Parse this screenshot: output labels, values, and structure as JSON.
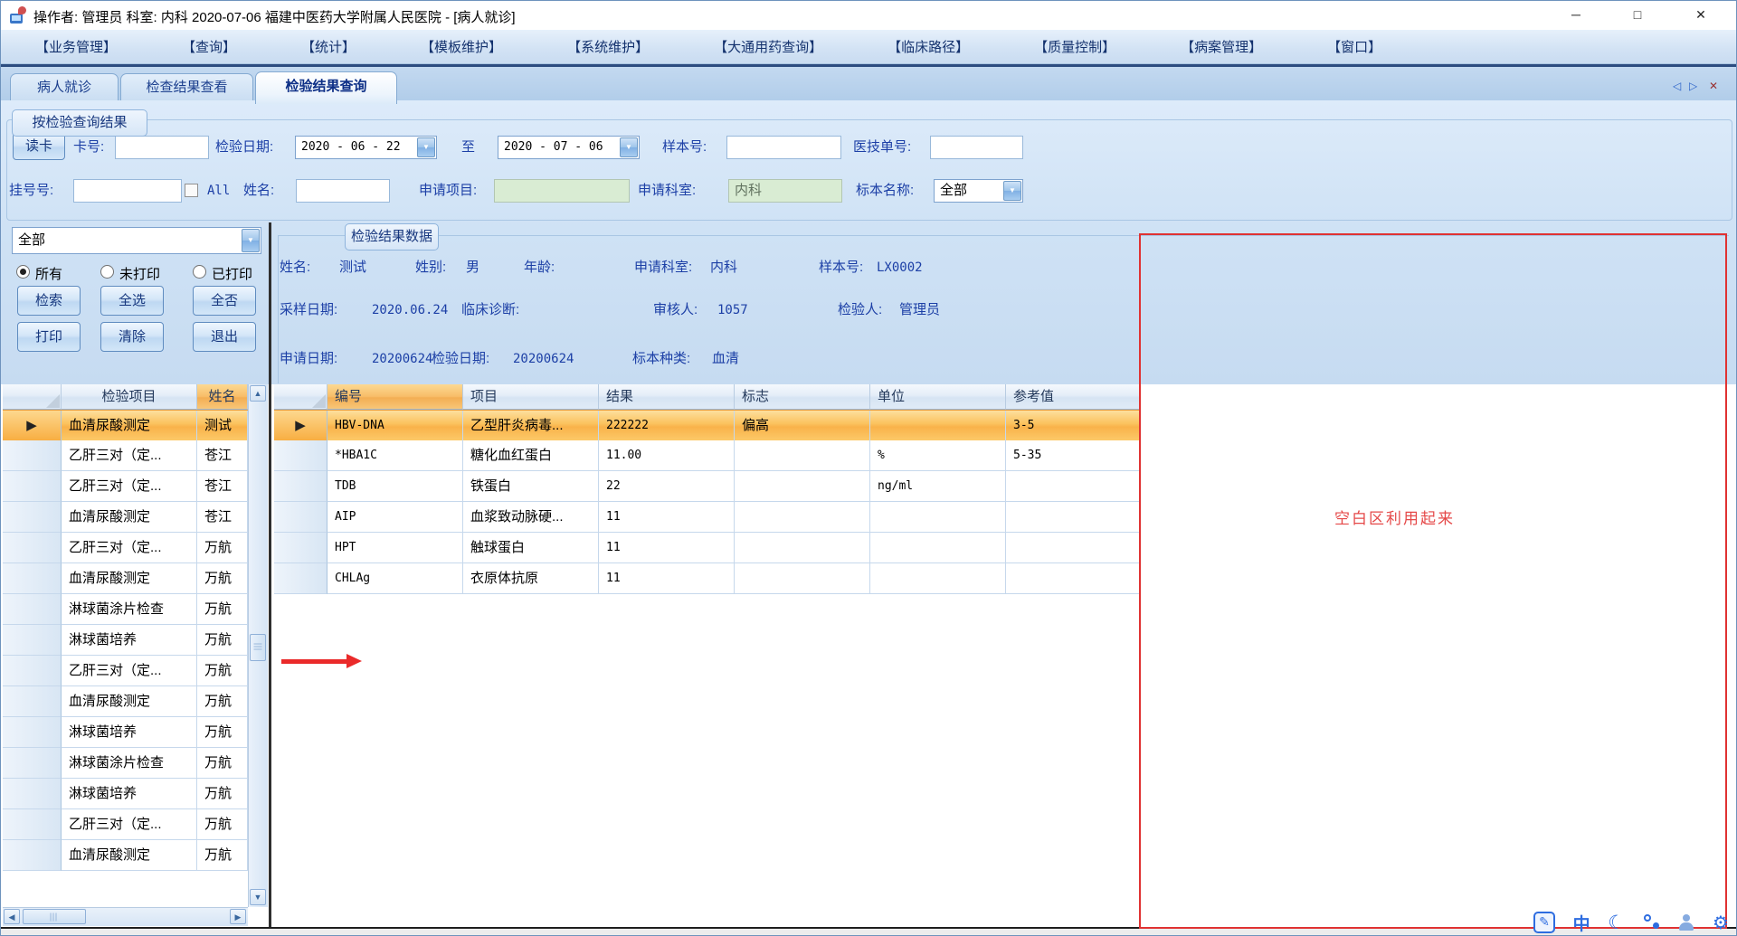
{
  "window": {
    "title": "操作者: 管理员 科室: 内科  2020-07-06  福建中医药大学附属人民医院 - [病人就诊]",
    "minimize": "─",
    "maximize": "□",
    "close": "✕"
  },
  "menu": {
    "items": [
      "【业务管理】",
      "【查询】",
      "【统计】",
      "【模板维护】",
      "【系统维护】",
      "【大通用药查询】",
      "【临床路径】",
      "【质量控制】",
      "【病案管理】",
      "【窗口】"
    ]
  },
  "tabs": {
    "items": [
      {
        "label": "病人就诊"
      },
      {
        "label": "检查结果查看"
      },
      {
        "label": "检验结果查询"
      }
    ],
    "nav_prev": "◁",
    "nav_next": "▷",
    "nav_close": "✕"
  },
  "query": {
    "group_label": "按检验查询结果",
    "read_card": "读卡",
    "card_no_label": "卡号:",
    "date_label": "检验日期:",
    "date_from": "2020 - 06 - 22",
    "to_label": "至",
    "date_to": "2020 - 07 - 06",
    "sample_label": "样本号:",
    "tech_no_label": "医技单号:",
    "reg_no_label": "挂号号:",
    "all_label": "All",
    "name_label": "姓名:",
    "apply_item_label": "申请项目:",
    "apply_dept_label": "申请科室:",
    "apply_dept_value": "内科",
    "specimen_label": "标本名称:",
    "specimen_value": "全部"
  },
  "left_panel": {
    "filter_value": "全部",
    "radio_all": "所有",
    "radio_unprinted": "未打印",
    "radio_printed": "已打印",
    "btn_search": "检索",
    "btn_select_all": "全选",
    "btn_select_none": "全否",
    "btn_print": "打印",
    "btn_clear": "清除",
    "btn_exit": "退出",
    "table": {
      "col_item": "检验项目",
      "col_name": "姓名",
      "rows": [
        {
          "item": "血清尿酸测定",
          "name": "测试"
        },
        {
          "item": "乙肝三对（定...",
          "name": "苍江"
        },
        {
          "item": "乙肝三对（定...",
          "name": "苍江"
        },
        {
          "item": "血清尿酸测定",
          "name": "苍江"
        },
        {
          "item": "乙肝三对（定...",
          "name": "万航"
        },
        {
          "item": "血清尿酸测定",
          "name": "万航"
        },
        {
          "item": "淋球菌涂片检查",
          "name": "万航"
        },
        {
          "item": "淋球菌培养",
          "name": "万航"
        },
        {
          "item": "乙肝三对（定...",
          "name": "万航"
        },
        {
          "item": "血清尿酸测定",
          "name": "万航"
        },
        {
          "item": "淋球菌培养",
          "name": "万航"
        },
        {
          "item": "淋球菌涂片检查",
          "name": "万航"
        },
        {
          "item": "淋球菌培养",
          "name": "万航"
        },
        {
          "item": "乙肝三对（定...",
          "name": "万航"
        },
        {
          "item": "血清尿酸测定",
          "name": "万航"
        }
      ]
    }
  },
  "results": {
    "group_label": "检验结果数据",
    "info": {
      "name_label": "姓名:",
      "name": "测试",
      "sex_label": "姓别:",
      "sex": "男",
      "age_label": "年龄:",
      "age": "",
      "dept_label": "申请科室:",
      "dept": "内科",
      "sample_label": "样本号:",
      "sample_no": "LX0002",
      "sampling_date_label": "采样日期:",
      "sampling_date": "2020.06.24",
      "diagnosis_label": "临床诊断:",
      "diagnosis": "",
      "reviewer_label": "审核人:",
      "reviewer": "1057",
      "tester_label": "检验人:",
      "tester": "管理员",
      "apply_date_label": "申请日期:",
      "apply_date": "20200624",
      "test_date_label": "检验日期:",
      "test_date": "20200624",
      "specimen_type_label": "标本种类:",
      "specimen_type": "血清"
    },
    "table": {
      "headers": {
        "code": "编号",
        "item": "项目",
        "result": "结果",
        "flag": "标志",
        "unit": "单位",
        "ref": "参考值"
      },
      "rows": [
        {
          "code": "HBV-DNA",
          "item": "乙型肝炎病毒...",
          "result": "222222",
          "flag": "偏高",
          "unit": "",
          "ref": "3-5"
        },
        {
          "code": "*HBA1C",
          "item": "糖化血红蛋白",
          "result": "11.00",
          "flag": "",
          "unit": "%",
          "ref": "5-35"
        },
        {
          "code": "TDB",
          "item": "铁蛋白",
          "result": "22",
          "flag": "",
          "unit": "ng/ml",
          "ref": ""
        },
        {
          "code": "AIP",
          "item": "血浆致动脉硬...",
          "result": "11",
          "flag": "",
          "unit": "",
          "ref": ""
        },
        {
          "code": "HPT",
          "item": "触球蛋白",
          "result": "11",
          "flag": "",
          "unit": "",
          "ref": ""
        },
        {
          "code": "CHLAg",
          "item": "衣原体抗原",
          "result": "11",
          "flag": "",
          "unit": "",
          "ref": ""
        }
      ]
    }
  },
  "annotation": {
    "blank_area_text": "空白区利用起来"
  },
  "ime": {
    "zh_mode": "中"
  },
  "glyphs": {
    "dropdown": "▼",
    "row_marker": "▶",
    "scroll_up": "▲",
    "scroll_down": "▼",
    "scroll_left": "◀",
    "scroll_right": "▶",
    "pen": "✎",
    "moon": "☾",
    "gear": "⚙"
  },
  "colors": {
    "annotation_red": "#e03232",
    "selection_orange": "#f9b24a",
    "ime_blue": "#2e6de0",
    "accent_blue": "#1c3fa6"
  }
}
